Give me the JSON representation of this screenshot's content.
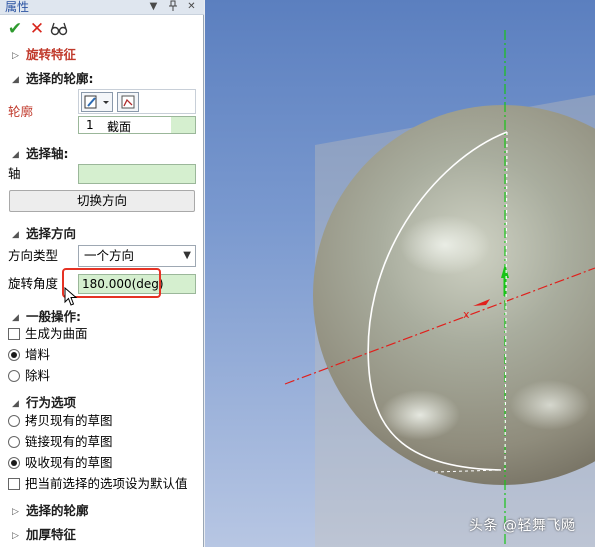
{
  "panel": {
    "title": "属性",
    "title_buttons": {
      "dropdown": "▼",
      "pin": "ㅁ",
      "close": "✕"
    },
    "toolbar": {
      "ok": "✔",
      "cancel": "✕",
      "preview": "60"
    },
    "feature_title": "旋转特征",
    "profile_section": {
      "header": "选择的轮廓:",
      "label": "轮廓",
      "row_index": "1",
      "row_value": "截面"
    },
    "axis_section": {
      "header": "选择轴:",
      "label": "轴",
      "axis_value": "",
      "switch_button": "切换方向"
    },
    "direction_section": {
      "header": "选择方向",
      "type_label": "方向类型",
      "type_value": "一个方向",
      "angle_label": "旋转角度",
      "angle_value": "180.000(deg)"
    },
    "general_section": {
      "header": "一般操作:",
      "surface_option": "生成为曲面",
      "add_option": "增料",
      "remove_option": "除料"
    },
    "behavior_section": {
      "header": "行为选项",
      "copy_option": "拷贝现有的草图",
      "link_option": "链接现有的草图",
      "absorb_option": "吸收现有的草图",
      "default_option": "把当前选择的选项设为默认值"
    },
    "collapsed_profile": "选择的轮廓",
    "collapsed_thicken": "加厚特征"
  },
  "viewport": {
    "axis_label": "x",
    "sphere_color": "#8f8c7c",
    "axis_red": "#e0201c",
    "axis_green": "#18c418"
  },
  "watermark": "头条 @轻舞飞飏",
  "colors": {
    "highlight_box": "#e53224",
    "field_green": "#d5efcf",
    "accent_blue": "#2c55a3"
  }
}
